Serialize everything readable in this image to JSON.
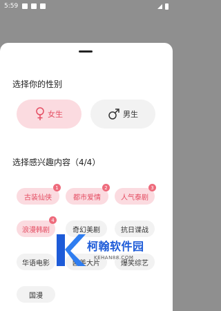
{
  "status_bar": {
    "time": "5:59"
  },
  "gender_section": {
    "title": "选择你的性别",
    "female_label": "女生",
    "male_label": "男生",
    "selected": "female"
  },
  "interest_section": {
    "title": "选择感兴趣内容（4/4）",
    "tags": [
      {
        "label": "古装仙侠",
        "badge": "1"
      },
      {
        "label": "都市爱情",
        "badge": "2"
      },
      {
        "label": "人气泰剧",
        "badge": "3"
      },
      {
        "label": "浪漫韩剧",
        "badge": "4"
      },
      {
        "label": "奇幻美剧"
      },
      {
        "label": "抗日谍战"
      },
      {
        "label": "华语电影"
      },
      {
        "label": "欧美大片"
      },
      {
        "label": "爆笑综艺"
      },
      {
        "label": "国漫"
      }
    ]
  },
  "watermark": {
    "name": "柯翰软件园",
    "domain": "KEHAN88.COM"
  },
  "colors": {
    "accent": "#e44d62",
    "selected_bg": "#fbdbe0",
    "tag_bg": "#f2f2f2",
    "brand_blue": "#1d5bd8"
  }
}
